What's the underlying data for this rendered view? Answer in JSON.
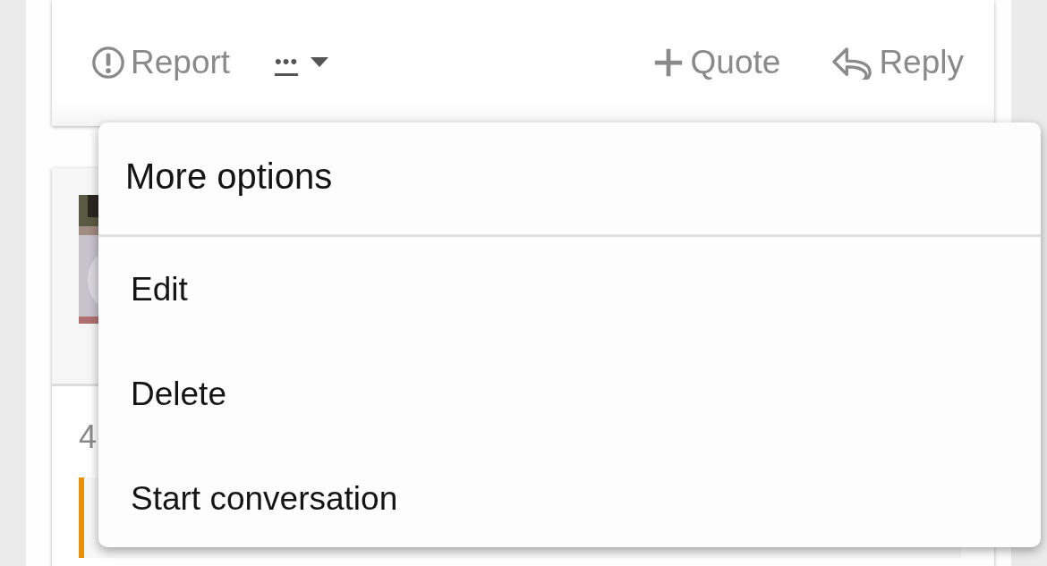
{
  "post_actions": [
    {
      "kind": "report",
      "label": "Report"
    },
    {
      "kind": "more",
      "label": "•••"
    },
    {
      "kind": "quote",
      "label": "Quote"
    },
    {
      "kind": "reply",
      "label": "Reply"
    }
  ],
  "next_post": {
    "post_number": "4"
  },
  "menu": {
    "title": "More options",
    "items": [
      {
        "label": "Edit"
      },
      {
        "label": "Delete"
      },
      {
        "label": "Start conversation"
      }
    ]
  }
}
